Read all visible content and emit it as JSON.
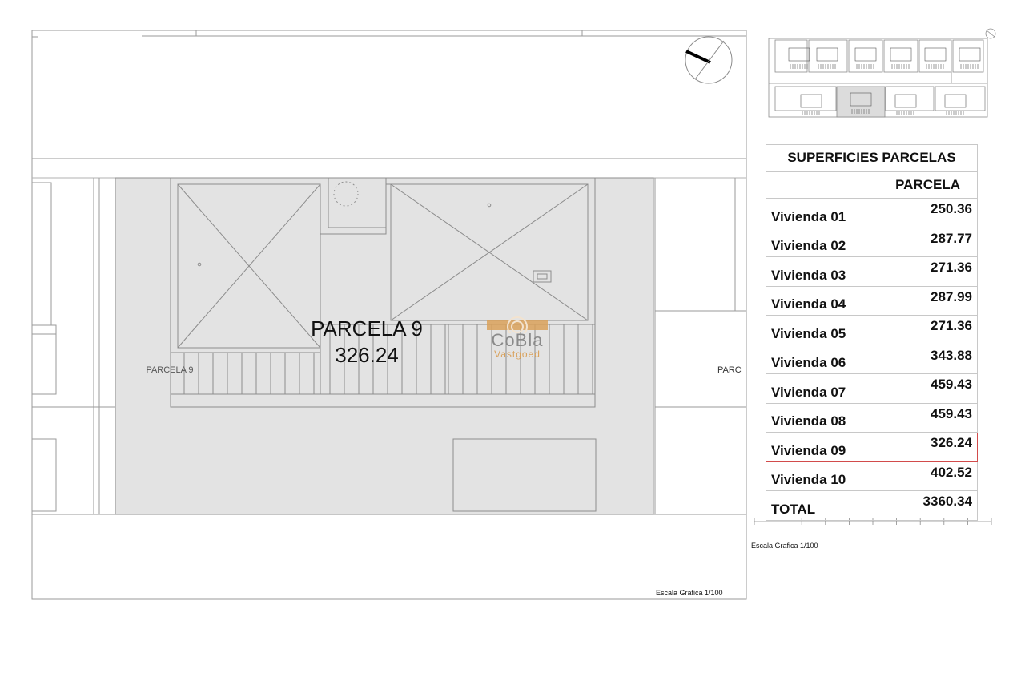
{
  "drawing": {
    "plot_label_big": "PARCELA 9",
    "plot_area_big": "326.24",
    "plot_label_small": "PARCELA 9",
    "neighbor_label_cut": "PARC",
    "scale_left": "Escala Grafica 1/100",
    "scale_right": "Escala Grafica 1/100"
  },
  "logo": {
    "brand": "CoBla",
    "sub": "Vastgoed",
    "accent_color": "#d9a15b"
  },
  "table": {
    "title": "SUPERFICIES PARCELAS",
    "column_header": "PARCELA",
    "rows": [
      {
        "name": "Vivienda 01",
        "value": "250.36"
      },
      {
        "name": "Vivienda 02",
        "value": "287.77"
      },
      {
        "name": "Vivienda 03",
        "value": "271.36"
      },
      {
        "name": "Vivienda 04",
        "value": "287.99"
      },
      {
        "name": "Vivienda 05",
        "value": "271.36"
      },
      {
        "name": "Vivienda 06",
        "value": "343.88"
      },
      {
        "name": "Vivienda 07",
        "value": "459.43"
      },
      {
        "name": "Vivienda 08",
        "value": "459.43"
      },
      {
        "name": "Vivienda 09",
        "value": "326.24",
        "highlighted": true
      },
      {
        "name": "Vivienda 10",
        "value": "402.52"
      }
    ],
    "total_label": "TOTAL",
    "total_value": "3360.34",
    "highlight_color": "#d24b4b"
  },
  "colors": {
    "plot_fill": "#e3e3e3",
    "line": "#8c8c8c"
  }
}
